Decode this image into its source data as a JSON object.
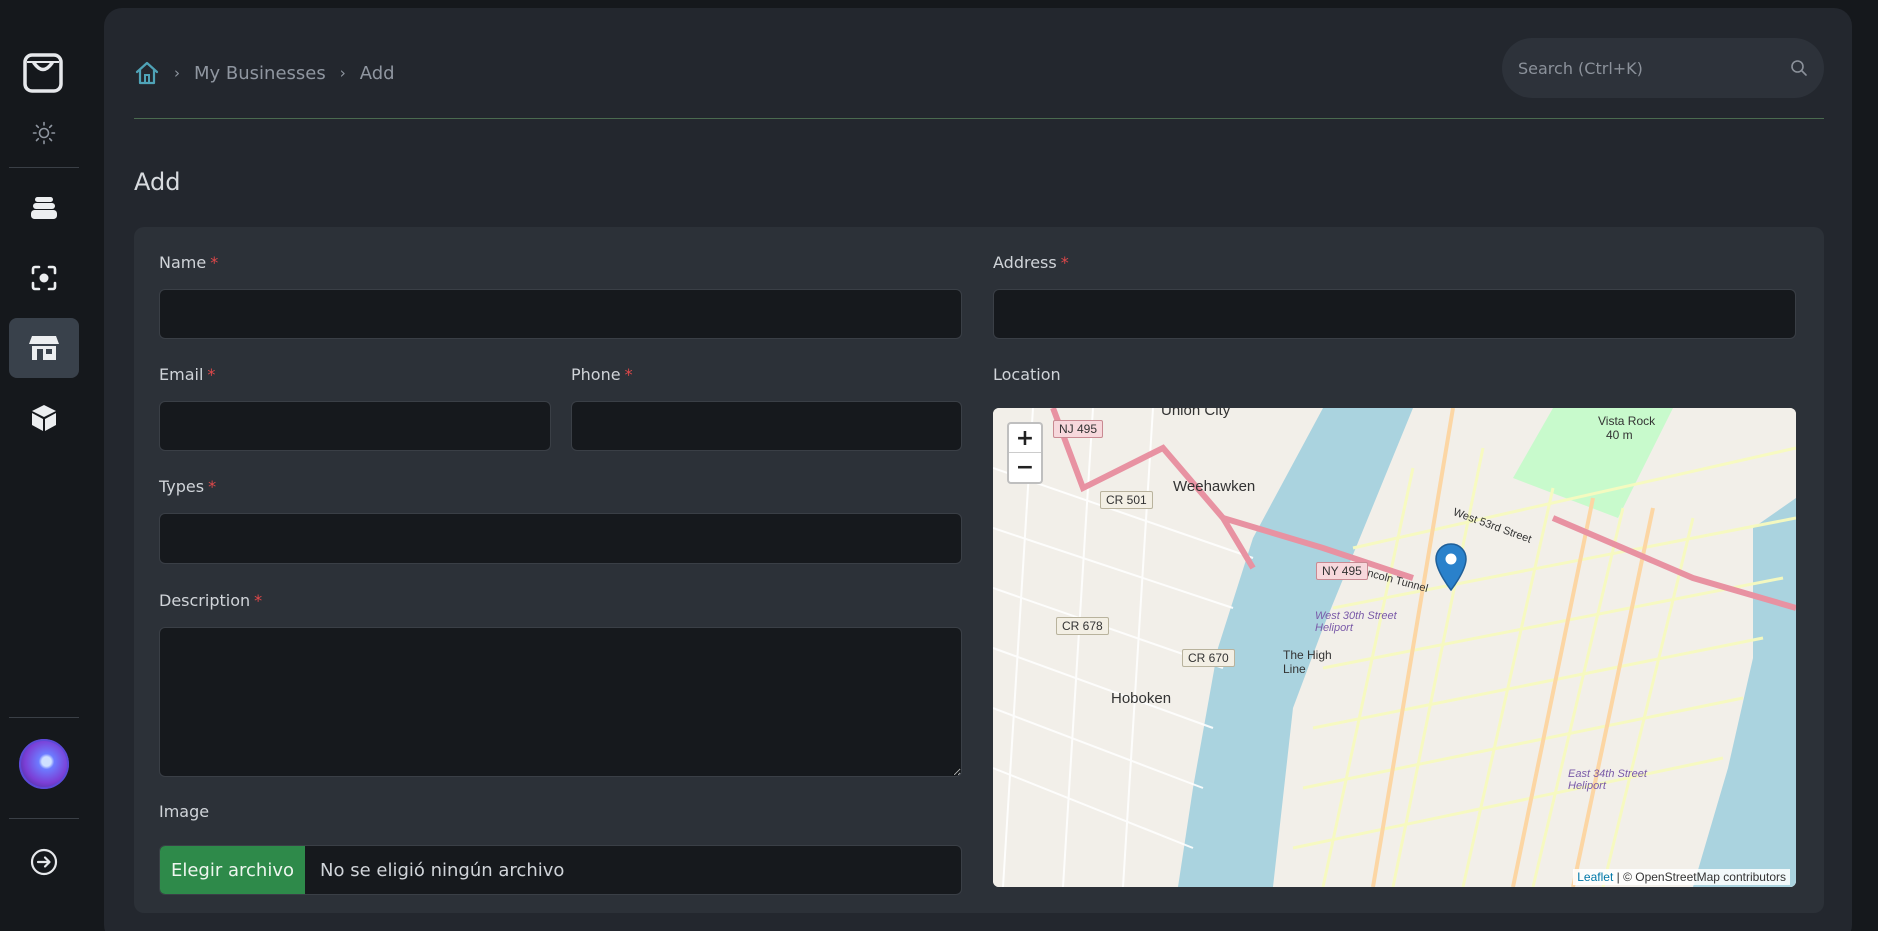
{
  "breadcrumb": {
    "items": [
      "My Businesses",
      "Add"
    ]
  },
  "search": {
    "placeholder": "Search (Ctrl+K)"
  },
  "page": {
    "title": "Add"
  },
  "form": {
    "name_label": "Name",
    "address_label": "Address",
    "email_label": "Email",
    "phone_label": "Phone",
    "location_label": "Location",
    "types_label": "Types",
    "description_label": "Description",
    "image_label": "Image",
    "required_mark": "*",
    "file_button": "Elegir archivo",
    "file_status": "No se eligió ningún archivo"
  },
  "map": {
    "zoom_in": "+",
    "zoom_out": "−",
    "attribution_link": "Leaflet",
    "attribution_text": " | © OpenStreetMap contributors",
    "labels": {
      "union_city": "Union City",
      "weehawken": "Weehawken",
      "hoboken": "Hoboken",
      "high_line": "The High Line",
      "vista_rock": "Vista Rock",
      "vista_rock_elev": "40 m",
      "heliport30": "West 30th Street Heliport",
      "heliport34": "East 34th Street Heliport",
      "west53": "West 53rd Street",
      "lincoln": "Lincoln Tunnel"
    },
    "shields": {
      "nj495": "NJ 495",
      "cr501": "CR 501",
      "ny495": "NY 495",
      "cr678": "CR 678",
      "cr670": "CR 670"
    },
    "colors": {
      "water": "#aad3df",
      "land": "#f2efe9",
      "park": "#c8facc",
      "motorway": "#e892a2",
      "primary": "#fcd6a4",
      "secondary": "#f7fabf",
      "marker": "#2a81cb"
    }
  }
}
